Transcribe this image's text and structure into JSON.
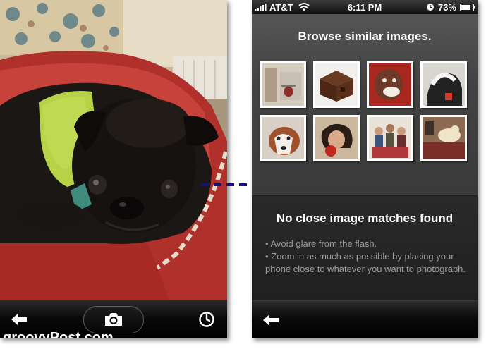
{
  "camera_screen": {
    "toolbar": {
      "back_icon": "arrow-left-icon",
      "shutter_icon": "camera-icon",
      "history_icon": "clock-icon"
    }
  },
  "results_screen": {
    "status_bar": {
      "carrier": "AT&T",
      "time": "6:11 PM",
      "battery": "73%"
    },
    "browse": {
      "title": "Browse similar images."
    },
    "message": {
      "title": "No close image matches found",
      "tips": [
        "• Avoid glare from the flash.",
        "• Zoom in as much as possible by placing your phone close to whatever you want to photograph."
      ]
    },
    "toolbar": {
      "back_icon": "arrow-left-icon"
    }
  },
  "watermark": "groovyPost.com",
  "colors": {
    "arrow": "#12127a",
    "title_text": "#ffffff",
    "tip_text": "#9c9c9c"
  }
}
